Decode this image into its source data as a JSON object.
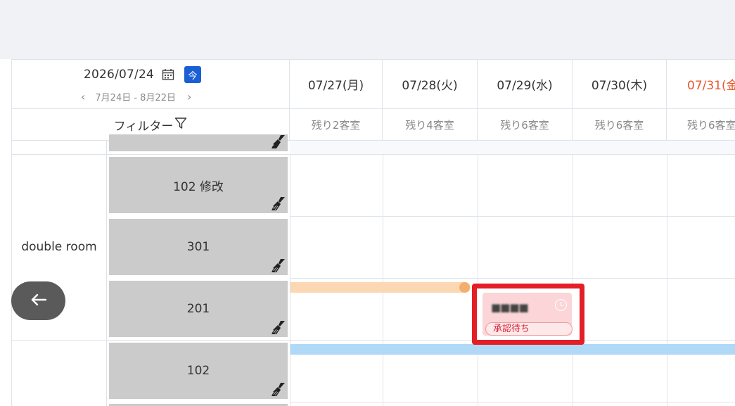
{
  "header": {
    "current_date": "2026/07/24",
    "today_label": "今",
    "range_label": "7月24日 - 8月22日",
    "prev_icon": "chevron-left-icon",
    "next_icon": "chevron-right-icon",
    "calendar_icon": "calendar-icon",
    "accent_color": "#1b5fd6"
  },
  "filter": {
    "label": "フィルター",
    "icon": "funnel-icon"
  },
  "columns": [
    {
      "date": "07/27(月)",
      "remaining": "残り2客室"
    },
    {
      "date": "07/28(火)",
      "remaining": "残り4客室"
    },
    {
      "date": "07/29(水)",
      "remaining": "残り6客室"
    },
    {
      "date": "07/30(木)",
      "remaining": "残り6客室"
    },
    {
      "date": "07/31(金",
      "remaining": "残り6客室",
      "highlight_color": "#e8562a"
    }
  ],
  "room_types": [
    {
      "name": "double room",
      "rooms": [
        "102 修改",
        "301",
        "201"
      ]
    }
  ],
  "rooms": {
    "r1": "102 修改",
    "r2": "301",
    "r3": "201",
    "r4": "102"
  },
  "booking": {
    "guest_name": "■■■■",
    "status": "承認待ち",
    "status_icon": "clock-icon",
    "highlight_color": "#e31e26"
  },
  "back_button": {
    "icon": "arrow-left-icon"
  }
}
